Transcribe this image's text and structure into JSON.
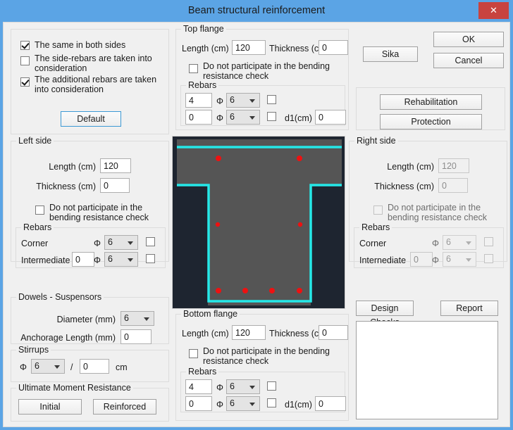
{
  "window": {
    "title": "Beam structural reinforcement",
    "close_label": "✕",
    "titlebar_color": "#5ba4e5",
    "close_color": "#c8433f"
  },
  "options_panel": {
    "checkboxes": [
      {
        "label": "The same in both sides",
        "checked": true
      },
      {
        "label": "The side-rebars are taken into consideration",
        "checked": false
      },
      {
        "label": "The additional rebars are taken into consideration",
        "checked": true
      }
    ],
    "default_button": "Default"
  },
  "top_flange": {
    "legend": "Top flange",
    "length_label": "Length (cm)",
    "length_value": "120",
    "thickness_label": "Thickness (cm)",
    "thickness_value": "0",
    "no_participate_label": "Do not participate in the bending resistance check",
    "no_participate_checked": false,
    "rebars_legend": "Rebars",
    "phi_symbol": "Φ",
    "row1_count": "4",
    "row1_diameter": "6",
    "row1_checked": false,
    "row2_count": "0",
    "row2_diameter": "6",
    "row2_checked": false,
    "d1_label": "d1(cm)",
    "d1_value": "0"
  },
  "bottom_flange": {
    "legend": "Bottom flange",
    "length_label": "Length (cm)",
    "length_value": "120",
    "thickness_label": "Thickness (cm)",
    "thickness_value": "0",
    "no_participate_label": "Do not participate in the bending resistance check",
    "no_participate_checked": false,
    "rebars_legend": "Rebars",
    "phi_symbol": "Φ",
    "row1_count": "4",
    "row1_diameter": "6",
    "row1_checked": false,
    "row2_count": "0",
    "row2_diameter": "6",
    "row2_checked": false,
    "d1_label": "d1(cm)",
    "d1_value": "0"
  },
  "left_side": {
    "legend": "Left side",
    "length_label": "Length (cm)",
    "length_value": "120",
    "thickness_label": "Thickness (cm)",
    "thickness_value": "0",
    "no_participate_label": "Do not participate in the bending resistance check",
    "no_participate_checked": false,
    "rebars_legend": "Rebars",
    "phi_symbol": "Φ",
    "corner_label": "Corner",
    "corner_diameter": "6",
    "corner_checked": false,
    "intermediate_label": "Intermediate",
    "intermediate_count": "0",
    "intermediate_diameter": "6",
    "intermediate_checked": false
  },
  "right_side": {
    "legend": "Right side",
    "disabled": true,
    "length_label": "Length (cm)",
    "length_value": "120",
    "thickness_label": "Thickness (cm)",
    "thickness_value": "0",
    "no_participate_label": "Do not participate in the bending resistance check",
    "no_participate_checked": false,
    "rebars_legend": "Rebars",
    "phi_symbol": "Φ",
    "corner_label": "Corner",
    "corner_diameter": "6",
    "corner_checked": false,
    "intermediate_label": "Internediate",
    "intermediate_count": "0",
    "intermediate_diameter": "6",
    "intermediate_checked": false
  },
  "dowels": {
    "legend": "Dowels - Suspensors",
    "diameter_label": "Diameter (mm)",
    "diameter_value": "6",
    "anchorage_label": "Anchorage Length (mm)",
    "anchorage_value": "0"
  },
  "stirrups": {
    "legend": "Stirrups",
    "phi_symbol": "Φ",
    "diameter_value": "6",
    "separator": "/",
    "spacing_value": "0",
    "unit": "cm"
  },
  "ultimate_moment": {
    "legend": "Ultimate Moment Resistance",
    "initial_button": "Initial",
    "reinforced_button": "Reinforced"
  },
  "actions": {
    "sika": "Sika",
    "ok": "OK",
    "cancel": "Cancel",
    "rehabilitation": "Rehabilitation",
    "protection": "Protection"
  },
  "report": {
    "design_checks": "Design Checks",
    "report_button": "Report",
    "output_text": ""
  },
  "diagram": {
    "name": "beam-cross-section",
    "background_color": "#1e2530",
    "concrete_color": "#555555",
    "stirrup_color": "#25e8e8",
    "rebar_color": "#ee1111",
    "top_rebars": 2,
    "mid_rebars": 2,
    "bottom_rebars": 4
  }
}
